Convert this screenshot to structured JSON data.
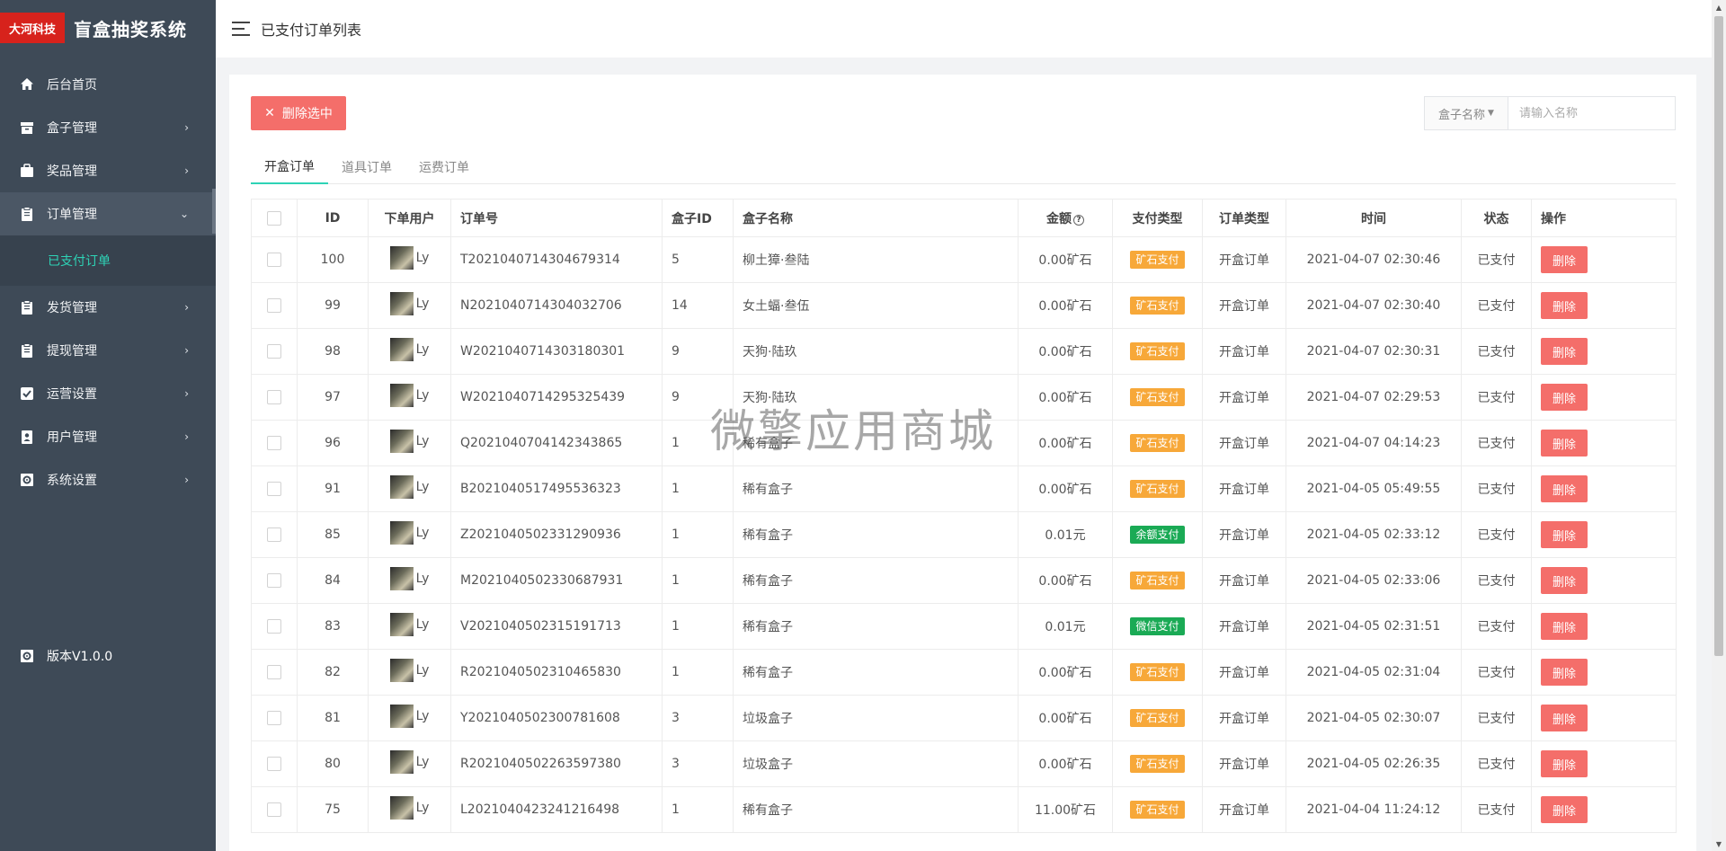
{
  "brand": {
    "logo_text": "大河科技",
    "title": "盲盒抽奖系统"
  },
  "sidebar": {
    "items": [
      {
        "label": "后台首页",
        "icon": "home-icon",
        "chevron": ""
      },
      {
        "label": "盒子管理",
        "icon": "box-icon",
        "chevron": "›"
      },
      {
        "label": "奖品管理",
        "icon": "gift-icon",
        "chevron": "›"
      },
      {
        "label": "订单管理",
        "icon": "clipboard-icon",
        "chevron": "⌄"
      },
      {
        "label": "发货管理",
        "icon": "clipboard-icon",
        "chevron": "›"
      },
      {
        "label": "提现管理",
        "icon": "clipboard-icon",
        "chevron": "›"
      },
      {
        "label": "运营设置",
        "icon": "check-badge-icon",
        "chevron": "›"
      },
      {
        "label": "用户管理",
        "icon": "user-card-icon",
        "chevron": "›"
      },
      {
        "label": "系统设置",
        "icon": "gear-icon",
        "chevron": "›"
      }
    ],
    "sub_item": "已支付订单",
    "version": "版本V1.0.0"
  },
  "header": {
    "title": "已支付订单列表"
  },
  "toolbar": {
    "delete_selected": "删除选中",
    "search_select": "盒子名称",
    "search_placeholder": "请输入名称"
  },
  "tabs": [
    "开盒订单",
    "道具订单",
    "运费订单"
  ],
  "table": {
    "headers": [
      "ID",
      "下单用户",
      "订单号",
      "盒子ID",
      "盒子名称",
      "金额",
      "支付类型",
      "订单类型",
      "时间",
      "状态",
      "操作"
    ],
    "rows": [
      {
        "id": "100",
        "user": "Ly",
        "order_no": "T2021040714304679314",
        "box_id": "5",
        "box_name": "柳土獐·叁陆",
        "amount": "0.00矿石",
        "pay_type": "矿石支付",
        "pay_kind": "ore",
        "order_type": "开盒订单",
        "time": "2021-04-07 02:30:46",
        "status": "已支付",
        "action": "删除"
      },
      {
        "id": "99",
        "user": "Ly",
        "order_no": "N2021040714304032706",
        "box_id": "14",
        "box_name": "女土蝠·叁伍",
        "amount": "0.00矿石",
        "pay_type": "矿石支付",
        "pay_kind": "ore",
        "order_type": "开盒订单",
        "time": "2021-04-07 02:30:40",
        "status": "已支付",
        "action": "删除"
      },
      {
        "id": "98",
        "user": "Ly",
        "order_no": "W2021040714303180301",
        "box_id": "9",
        "box_name": "天狗·陆玖",
        "amount": "0.00矿石",
        "pay_type": "矿石支付",
        "pay_kind": "ore",
        "order_type": "开盒订单",
        "time": "2021-04-07 02:30:31",
        "status": "已支付",
        "action": "删除"
      },
      {
        "id": "97",
        "user": "Ly",
        "order_no": "W2021040714295325439",
        "box_id": "9",
        "box_name": "天狗·陆玖",
        "amount": "0.00矿石",
        "pay_type": "矿石支付",
        "pay_kind": "ore",
        "order_type": "开盒订单",
        "time": "2021-04-07 02:29:53",
        "status": "已支付",
        "action": "删除"
      },
      {
        "id": "96",
        "user": "Ly",
        "order_no": "Q2021040704142343865",
        "box_id": "1",
        "box_name": "稀有盒子",
        "amount": "0.00矿石",
        "pay_type": "矿石支付",
        "pay_kind": "ore",
        "order_type": "开盒订单",
        "time": "2021-04-07 04:14:23",
        "status": "已支付",
        "action": "删除"
      },
      {
        "id": "91",
        "user": "Ly",
        "order_no": "B2021040517495536323",
        "box_id": "1",
        "box_name": "稀有盒子",
        "amount": "0.00矿石",
        "pay_type": "矿石支付",
        "pay_kind": "ore",
        "order_type": "开盒订单",
        "time": "2021-04-05 05:49:55",
        "status": "已支付",
        "action": "删除"
      },
      {
        "id": "85",
        "user": "Ly",
        "order_no": "Z2021040502331290936",
        "box_id": "1",
        "box_name": "稀有盒子",
        "amount": "0.01元",
        "pay_type": "余额支付",
        "pay_kind": "bal",
        "order_type": "开盒订单",
        "time": "2021-04-05 02:33:12",
        "status": "已支付",
        "action": "删除"
      },
      {
        "id": "84",
        "user": "Ly",
        "order_no": "M2021040502330687931",
        "box_id": "1",
        "box_name": "稀有盒子",
        "amount": "0.00矿石",
        "pay_type": "矿石支付",
        "pay_kind": "ore",
        "order_type": "开盒订单",
        "time": "2021-04-05 02:33:06",
        "status": "已支付",
        "action": "删除"
      },
      {
        "id": "83",
        "user": "Ly",
        "order_no": "V2021040502315191713",
        "box_id": "1",
        "box_name": "稀有盒子",
        "amount": "0.01元",
        "pay_type": "微信支付",
        "pay_kind": "wx",
        "order_type": "开盒订单",
        "time": "2021-04-05 02:31:51",
        "status": "已支付",
        "action": "删除"
      },
      {
        "id": "82",
        "user": "Ly",
        "order_no": "R2021040502310465830",
        "box_id": "1",
        "box_name": "稀有盒子",
        "amount": "0.00矿石",
        "pay_type": "矿石支付",
        "pay_kind": "ore",
        "order_type": "开盒订单",
        "time": "2021-04-05 02:31:04",
        "status": "已支付",
        "action": "删除"
      },
      {
        "id": "81",
        "user": "Ly",
        "order_no": "Y2021040502300781608",
        "box_id": "3",
        "box_name": "垃圾盒子",
        "amount": "0.00矿石",
        "pay_type": "矿石支付",
        "pay_kind": "ore",
        "order_type": "开盒订单",
        "time": "2021-04-05 02:30:07",
        "status": "已支付",
        "action": "删除"
      },
      {
        "id": "80",
        "user": "Ly",
        "order_no": "R2021040502263597380",
        "box_id": "3",
        "box_name": "垃圾盒子",
        "amount": "0.00矿石",
        "pay_type": "矿石支付",
        "pay_kind": "ore",
        "order_type": "开盒订单",
        "time": "2021-04-05 02:26:35",
        "status": "已支付",
        "action": "删除"
      },
      {
        "id": "75",
        "user": "Ly",
        "order_no": "L2021040423241216498",
        "box_id": "1",
        "box_name": "稀有盒子",
        "amount": "11.00矿石",
        "pay_type": "矿石支付",
        "pay_kind": "ore",
        "order_type": "开盒订单",
        "time": "2021-04-04 11:24:12",
        "status": "已支付",
        "action": "删除"
      }
    ]
  },
  "watermark": "微擎应用商城",
  "colors": {
    "sidebar_bg": "#3e4a57",
    "accent": "#2ed3b6",
    "danger": "#f46e6a",
    "ore_badge": "#f7a839",
    "green_badge": "#1aaa55",
    "brand_red": "#d7221c"
  }
}
